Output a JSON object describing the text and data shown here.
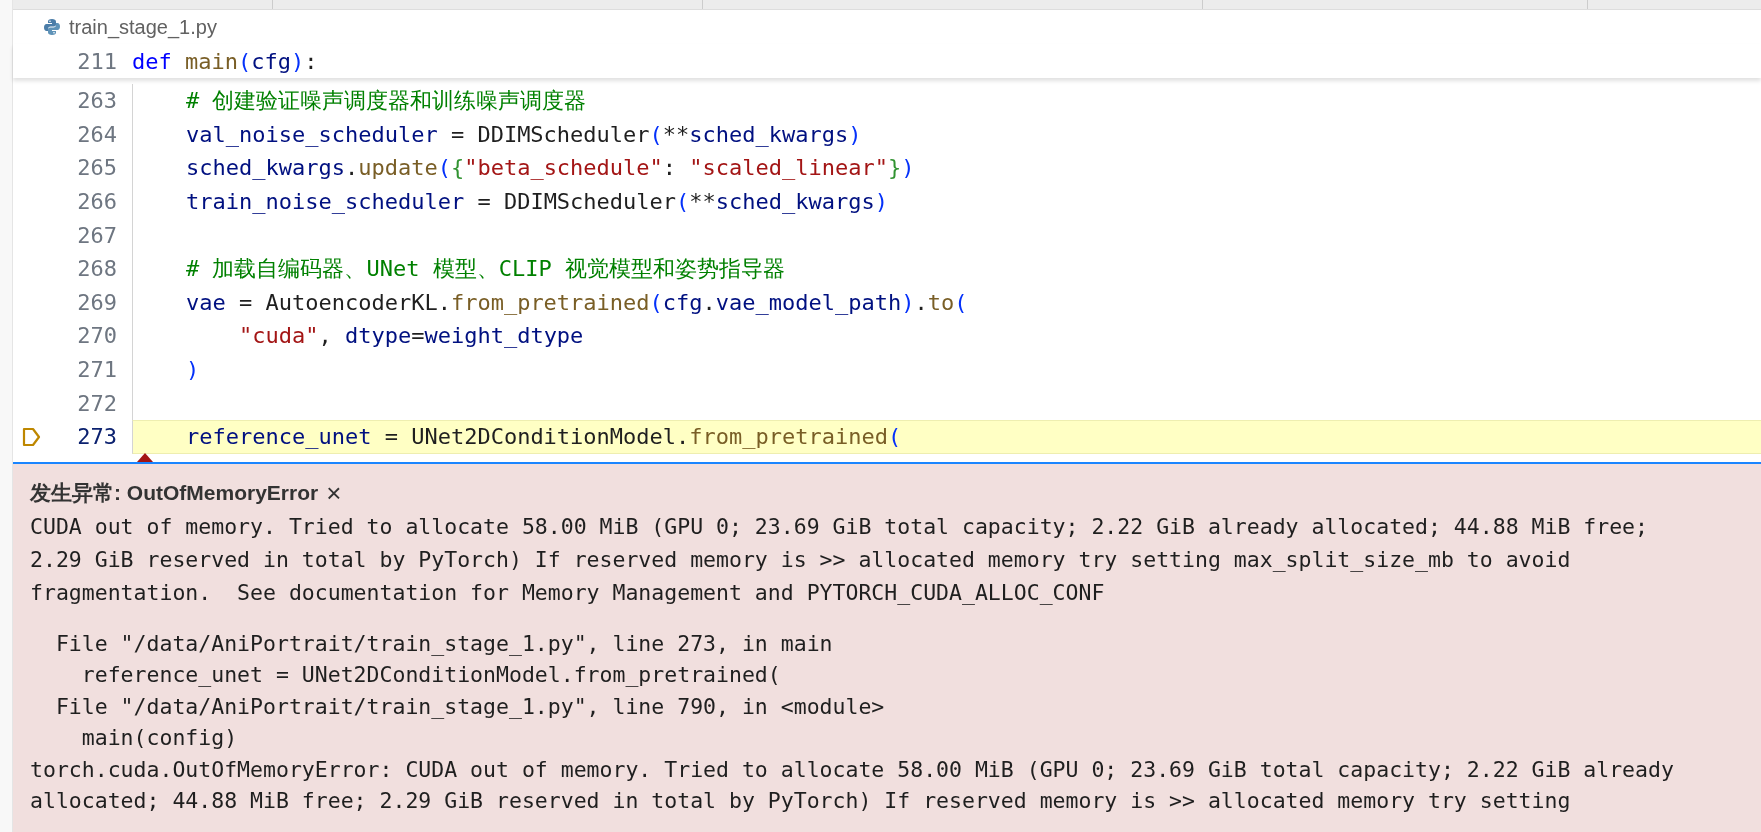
{
  "breadcrumb": {
    "file": "train_stage_1.py"
  },
  "sticky_line": {
    "number": "211",
    "tokens": [
      {
        "kind": "keyword",
        "text": "def "
      },
      {
        "kind": "function",
        "text": "main"
      },
      {
        "kind": "bracket",
        "text": "("
      },
      {
        "kind": "variable",
        "text": "cfg"
      },
      {
        "kind": "bracket",
        "text": ")"
      },
      {
        "kind": "plain",
        "text": ":"
      }
    ]
  },
  "lines": [
    {
      "number": "263",
      "current": false,
      "tokens": [
        {
          "kind": "comment",
          "text": "    # 创建验证噪声调度器和训练噪声调度器"
        }
      ]
    },
    {
      "number": "264",
      "current": false,
      "tokens": [
        {
          "kind": "variable",
          "text": "    val_noise_scheduler"
        },
        {
          "kind": "plain",
          "text": " = "
        },
        {
          "kind": "class",
          "text": "DDIMScheduler"
        },
        {
          "kind": "bracket",
          "text": "("
        },
        {
          "kind": "plain",
          "text": "**"
        },
        {
          "kind": "variable",
          "text": "sched_kwargs"
        },
        {
          "kind": "bracket",
          "text": ")"
        }
      ]
    },
    {
      "number": "265",
      "current": false,
      "tokens": [
        {
          "kind": "variable",
          "text": "    sched_kwargs"
        },
        {
          "kind": "plain",
          "text": "."
        },
        {
          "kind": "function",
          "text": "update"
        },
        {
          "kind": "bracket",
          "text": "("
        },
        {
          "kind": "bracket2",
          "text": "{"
        },
        {
          "kind": "string",
          "text": "\"beta_schedule\""
        },
        {
          "kind": "plain",
          "text": ": "
        },
        {
          "kind": "string",
          "text": "\"scaled_linear\""
        },
        {
          "kind": "bracket2",
          "text": "}"
        },
        {
          "kind": "bracket",
          "text": ")"
        }
      ]
    },
    {
      "number": "266",
      "current": false,
      "tokens": [
        {
          "kind": "variable",
          "text": "    train_noise_scheduler"
        },
        {
          "kind": "plain",
          "text": " = "
        },
        {
          "kind": "class",
          "text": "DDIMScheduler"
        },
        {
          "kind": "bracket",
          "text": "("
        },
        {
          "kind": "plain",
          "text": "**"
        },
        {
          "kind": "variable",
          "text": "sched_kwargs"
        },
        {
          "kind": "bracket",
          "text": ")"
        }
      ]
    },
    {
      "number": "267",
      "current": false
    },
    {
      "number": "268",
      "current": false,
      "tokens": [
        {
          "kind": "comment",
          "text": "    # 加载自编码器、UNet 模型、CLIP 视觉模型和姿势指导器"
        }
      ]
    },
    {
      "number": "269",
      "current": false,
      "tokens": [
        {
          "kind": "variable",
          "text": "    vae"
        },
        {
          "kind": "plain",
          "text": " = "
        },
        {
          "kind": "class",
          "text": "AutoencoderKL"
        },
        {
          "kind": "plain",
          "text": "."
        },
        {
          "kind": "function",
          "text": "from_pretrained"
        },
        {
          "kind": "bracket",
          "text": "("
        },
        {
          "kind": "variable",
          "text": "cfg"
        },
        {
          "kind": "plain",
          "text": "."
        },
        {
          "kind": "variable",
          "text": "vae_model_path"
        },
        {
          "kind": "bracket",
          "text": ")"
        },
        {
          "kind": "plain",
          "text": "."
        },
        {
          "kind": "function",
          "text": "to"
        },
        {
          "kind": "bracket",
          "text": "("
        }
      ]
    },
    {
      "number": "270",
      "current": false,
      "tokens": [
        {
          "kind": "string",
          "text": "        \"cuda\""
        },
        {
          "kind": "plain",
          "text": ", "
        },
        {
          "kind": "variable",
          "text": "dtype"
        },
        {
          "kind": "plain",
          "text": "="
        },
        {
          "kind": "variable",
          "text": "weight_dtype"
        }
      ]
    },
    {
      "number": "271",
      "current": false,
      "tokens": [
        {
          "kind": "bracket",
          "text": "    )"
        }
      ]
    },
    {
      "number": "272",
      "current": false
    },
    {
      "number": "273",
      "current": true,
      "tokens": [
        {
          "kind": "variable",
          "text": "    reference_unet"
        },
        {
          "kind": "plain",
          "text": " = "
        },
        {
          "kind": "class",
          "text": "UNet2DConditionModel"
        },
        {
          "kind": "plain",
          "text": "."
        },
        {
          "kind": "function",
          "text": "from_pretrained"
        },
        {
          "kind": "bracket",
          "text": "("
        }
      ]
    }
  ],
  "exception": {
    "title": "发生异常: OutOfMemoryError",
    "close": "×",
    "message": [
      "CUDA out of memory. Tried to allocate 58.00 MiB (GPU 0; 23.69 GiB total capacity; 2.22 GiB already allocated; 44.88 MiB free;",
      "2.29 GiB reserved in total by PyTorch) If reserved memory is >> allocated memory try setting max_split_size_mb to avoid",
      "fragmentation.  See documentation for Memory Management and PYTORCH_CUDA_ALLOC_CONF"
    ],
    "traceback": [
      "  File \"/data/AniPortrait/train_stage_1.py\", line 273, in main",
      "    reference_unet = UNet2DConditionModel.from_pretrained(",
      "  File \"/data/AniPortrait/train_stage_1.py\", line 790, in <module>",
      "    main(config)",
      "torch.cuda.OutOfMemoryError: CUDA out of memory. Tried to allocate 58.00 MiB (GPU 0; 23.69 GiB total capacity; 2.22 GiB already",
      "allocated; 44.88 MiB free; 2.29 GiB reserved in total by PyTorch) If reserved memory is >> allocated memory try setting"
    ]
  }
}
